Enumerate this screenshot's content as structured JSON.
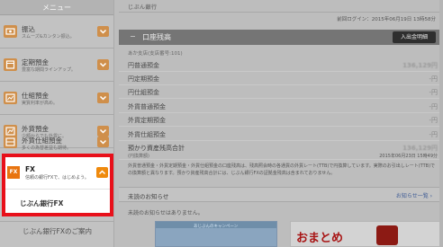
{
  "sidebar": {
    "header": "メニュー",
    "items": [
      {
        "title": "振込",
        "sub": "スムーズ&カンタン振込。",
        "icon": "transfer-icon"
      },
      {
        "title": "定期預金",
        "sub": "豊富な期間ラインアップ。",
        "icon": "time-deposit-icon"
      },
      {
        "title": "仕組預金",
        "sub": "実質利率が高め。",
        "icon": "structured-deposit-icon"
      },
      {
        "title": "外貨預金",
        "sub": "少額からでも外貨に。",
        "icon": "foreign-deposit-icon"
      },
      {
        "title": "外貨仕組預金",
        "sub": "多くの為替差益も期待。",
        "icon": "foreign-structured-icon"
      }
    ],
    "fx": {
      "icon_label": "FX",
      "title": "FX",
      "sub": "信頼の銀行FXで、はじめよう。",
      "link": "じぶん銀行FX"
    },
    "guide": "じぶん銀行FXのご案内"
  },
  "header": {
    "brand": "じぶん銀行",
    "last_login": "前回ログイン：2015年06月19日 13時58分"
  },
  "balance": {
    "panel_title": "口座残高",
    "deposit_button": "入出金明細",
    "account_type": "あか支店(支店番号:101)",
    "rows": [
      {
        "label": "円普通預金",
        "value": "136,129円"
      },
      {
        "label": "円定期預金",
        "value": "-円"
      },
      {
        "label": "円仕組預金",
        "value": "-円"
      },
      {
        "label": "外貨普通預金",
        "value": "-円"
      },
      {
        "label": "外貨定期預金",
        "value": "-円"
      },
      {
        "label": "外貨仕組預金",
        "value": "-円"
      }
    ],
    "total_label": "預かり資産残高合計",
    "total_sub": "(円換算額)",
    "total_value": "136,129円",
    "total_date": "2015年06月23日 15時49分",
    "note": "外貨普通預金・外貨定期預金・外貨仕組預金の口座残高は、残高照会時の各通貨の外貨レート(TTB)で円換算しています。実際のお引出しレート(TTB)での換算額と異なります。預かり資産残高合計には、じぶん銀行FXの証拠金残高は含まれておりません。"
  },
  "notices": {
    "title": "未読のお知らせ",
    "more": "お知らせ一覧 ›",
    "empty": "未読のお知らせはありません。"
  },
  "banners": {
    "left_tag": "あじぶんのキャンペーン",
    "right_text": "おまとめ"
  }
}
